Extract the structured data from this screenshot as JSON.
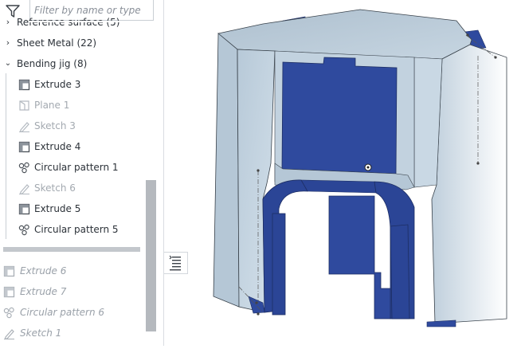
{
  "filter": {
    "placeholder": "Filter by name or type",
    "icon": "filter-icon"
  },
  "tree": {
    "reference_surface": {
      "label": "Reference surface (5)",
      "expanded": false
    },
    "sheet_metal": {
      "label": "Sheet Metal (22)",
      "expanded": false
    },
    "bending_jig": {
      "label": "Bending jig (8)",
      "expanded": true,
      "items": [
        {
          "label": "Extrude 3",
          "icon": "extrude-icon",
          "state": "normal"
        },
        {
          "label": "Plane 1",
          "icon": "plane-icon",
          "state": "hidden"
        },
        {
          "label": "Sketch 3",
          "icon": "sketch-icon",
          "state": "hidden"
        },
        {
          "label": "Extrude 4",
          "icon": "extrude-icon",
          "state": "normal"
        },
        {
          "label": "Circular pattern 1",
          "icon": "circular-pattern-icon",
          "state": "normal"
        },
        {
          "label": "Sketch 6",
          "icon": "sketch-icon",
          "state": "hidden"
        },
        {
          "label": "Extrude 5",
          "icon": "extrude-icon",
          "state": "normal"
        },
        {
          "label": "Circular pattern 5",
          "icon": "circular-pattern-icon",
          "state": "normal"
        }
      ]
    },
    "rolled_back": [
      {
        "label": "Extrude 6",
        "icon": "extrude-icon"
      },
      {
        "label": "Extrude 7",
        "icon": "extrude-icon"
      },
      {
        "label": "Circular pattern 6",
        "icon": "circular-pattern-icon"
      },
      {
        "label": "Sketch 1",
        "icon": "sketch-icon"
      }
    ]
  },
  "colors": {
    "part_light": "#c7d6e2",
    "part_dark_blue": "#2f4a9e",
    "text": "#2b3138",
    "faded_text": "#a3a9b0"
  }
}
